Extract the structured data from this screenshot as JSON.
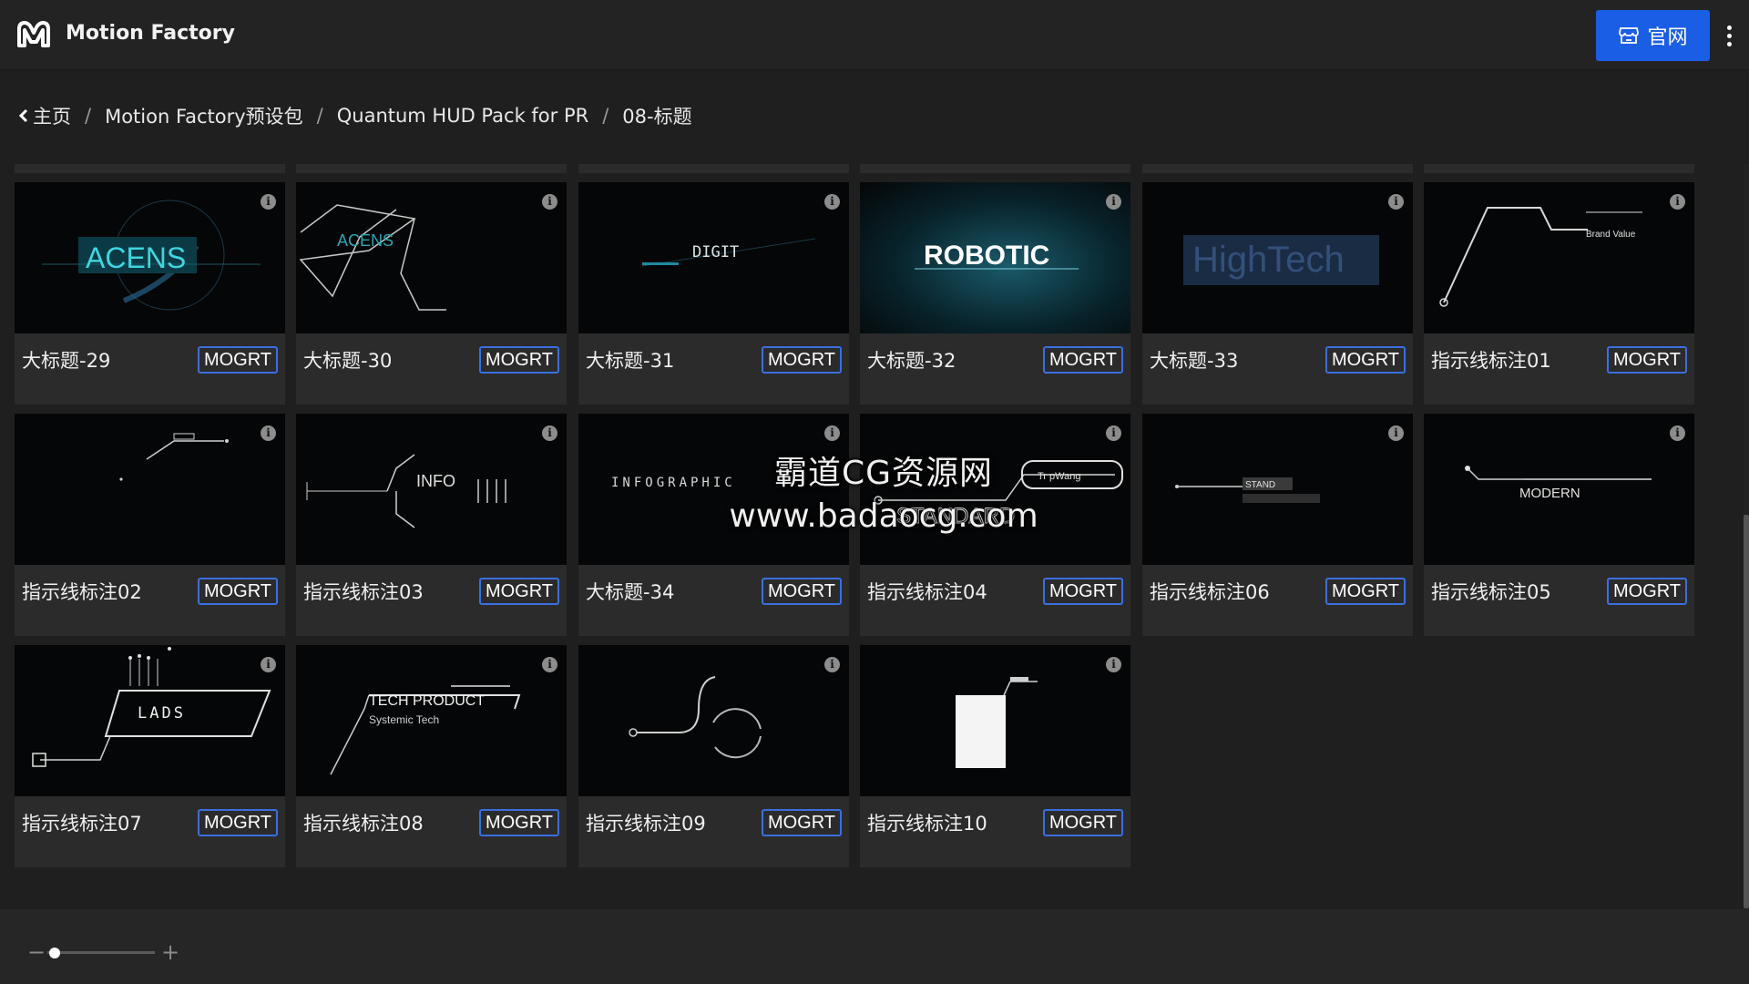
{
  "app": {
    "title": "Motion Factory"
  },
  "header": {
    "site_button_label": "官网"
  },
  "breadcrumb": [
    "主页",
    "Motion Factory预设包",
    "Quantum HUD Pack for PR",
    "08-标题"
  ],
  "cards": [
    {
      "label": "大标题-29",
      "button": "MOGRT",
      "thumb_text": "ACENS"
    },
    {
      "label": "大标题-30",
      "button": "MOGRT",
      "thumb_text": "ACENS"
    },
    {
      "label": "大标题-31",
      "button": "MOGRT",
      "thumb_text": "DIGIT"
    },
    {
      "label": "大标题-32",
      "button": "MOGRT",
      "thumb_text": "ROBOTIC"
    },
    {
      "label": "大标题-33",
      "button": "MOGRT",
      "thumb_text": "HighTech"
    },
    {
      "label": "指示线标注01",
      "button": "MOGRT",
      "thumb_text": "Brand Value"
    },
    {
      "label": "指示线标注02",
      "button": "MOGRT",
      "thumb_text": ""
    },
    {
      "label": "指示线标注03",
      "button": "MOGRT",
      "thumb_text": "INFO"
    },
    {
      "label": "大标题-34",
      "button": "MOGRT",
      "thumb_text": "INFOGRAPHIC"
    },
    {
      "label": "指示线标注04",
      "button": "MOGRT",
      "thumb_text": "STANDARD"
    },
    {
      "label": "指示线标注06",
      "button": "MOGRT",
      "thumb_text": "STAND"
    },
    {
      "label": "指示线标注05",
      "button": "MOGRT",
      "thumb_text": "MODERN"
    },
    {
      "label": "指示线标注07",
      "button": "MOGRT",
      "thumb_text": "LADS"
    },
    {
      "label": "指示线标注08",
      "button": "MOGRT",
      "thumb_text": "TECH PRODUCT"
    },
    {
      "label": "指示线标注09",
      "button": "MOGRT",
      "thumb_text": ""
    },
    {
      "label": "指示线标注10",
      "button": "MOGRT",
      "thumb_text": ""
    }
  ],
  "thumb_extra": {
    "tech_sub": "Systemic Tech",
    "standard_tag": "Tr pWang"
  },
  "zoom": {
    "level": 0.0
  },
  "watermark": {
    "line1": "霸道CG资源网",
    "line2": "www.badaocg.com"
  },
  "colors": {
    "accent": "#1b5ee6",
    "mogrt_border": "#3a6fe0",
    "background": "#1f1f1f",
    "card": "#2b2b2b"
  },
  "icons": [
    "motion-factory-logo-icon",
    "store-icon",
    "more-vertical-icon",
    "chevron-left-icon",
    "info-icon",
    "zoom-minus-icon",
    "zoom-plus-icon"
  ]
}
